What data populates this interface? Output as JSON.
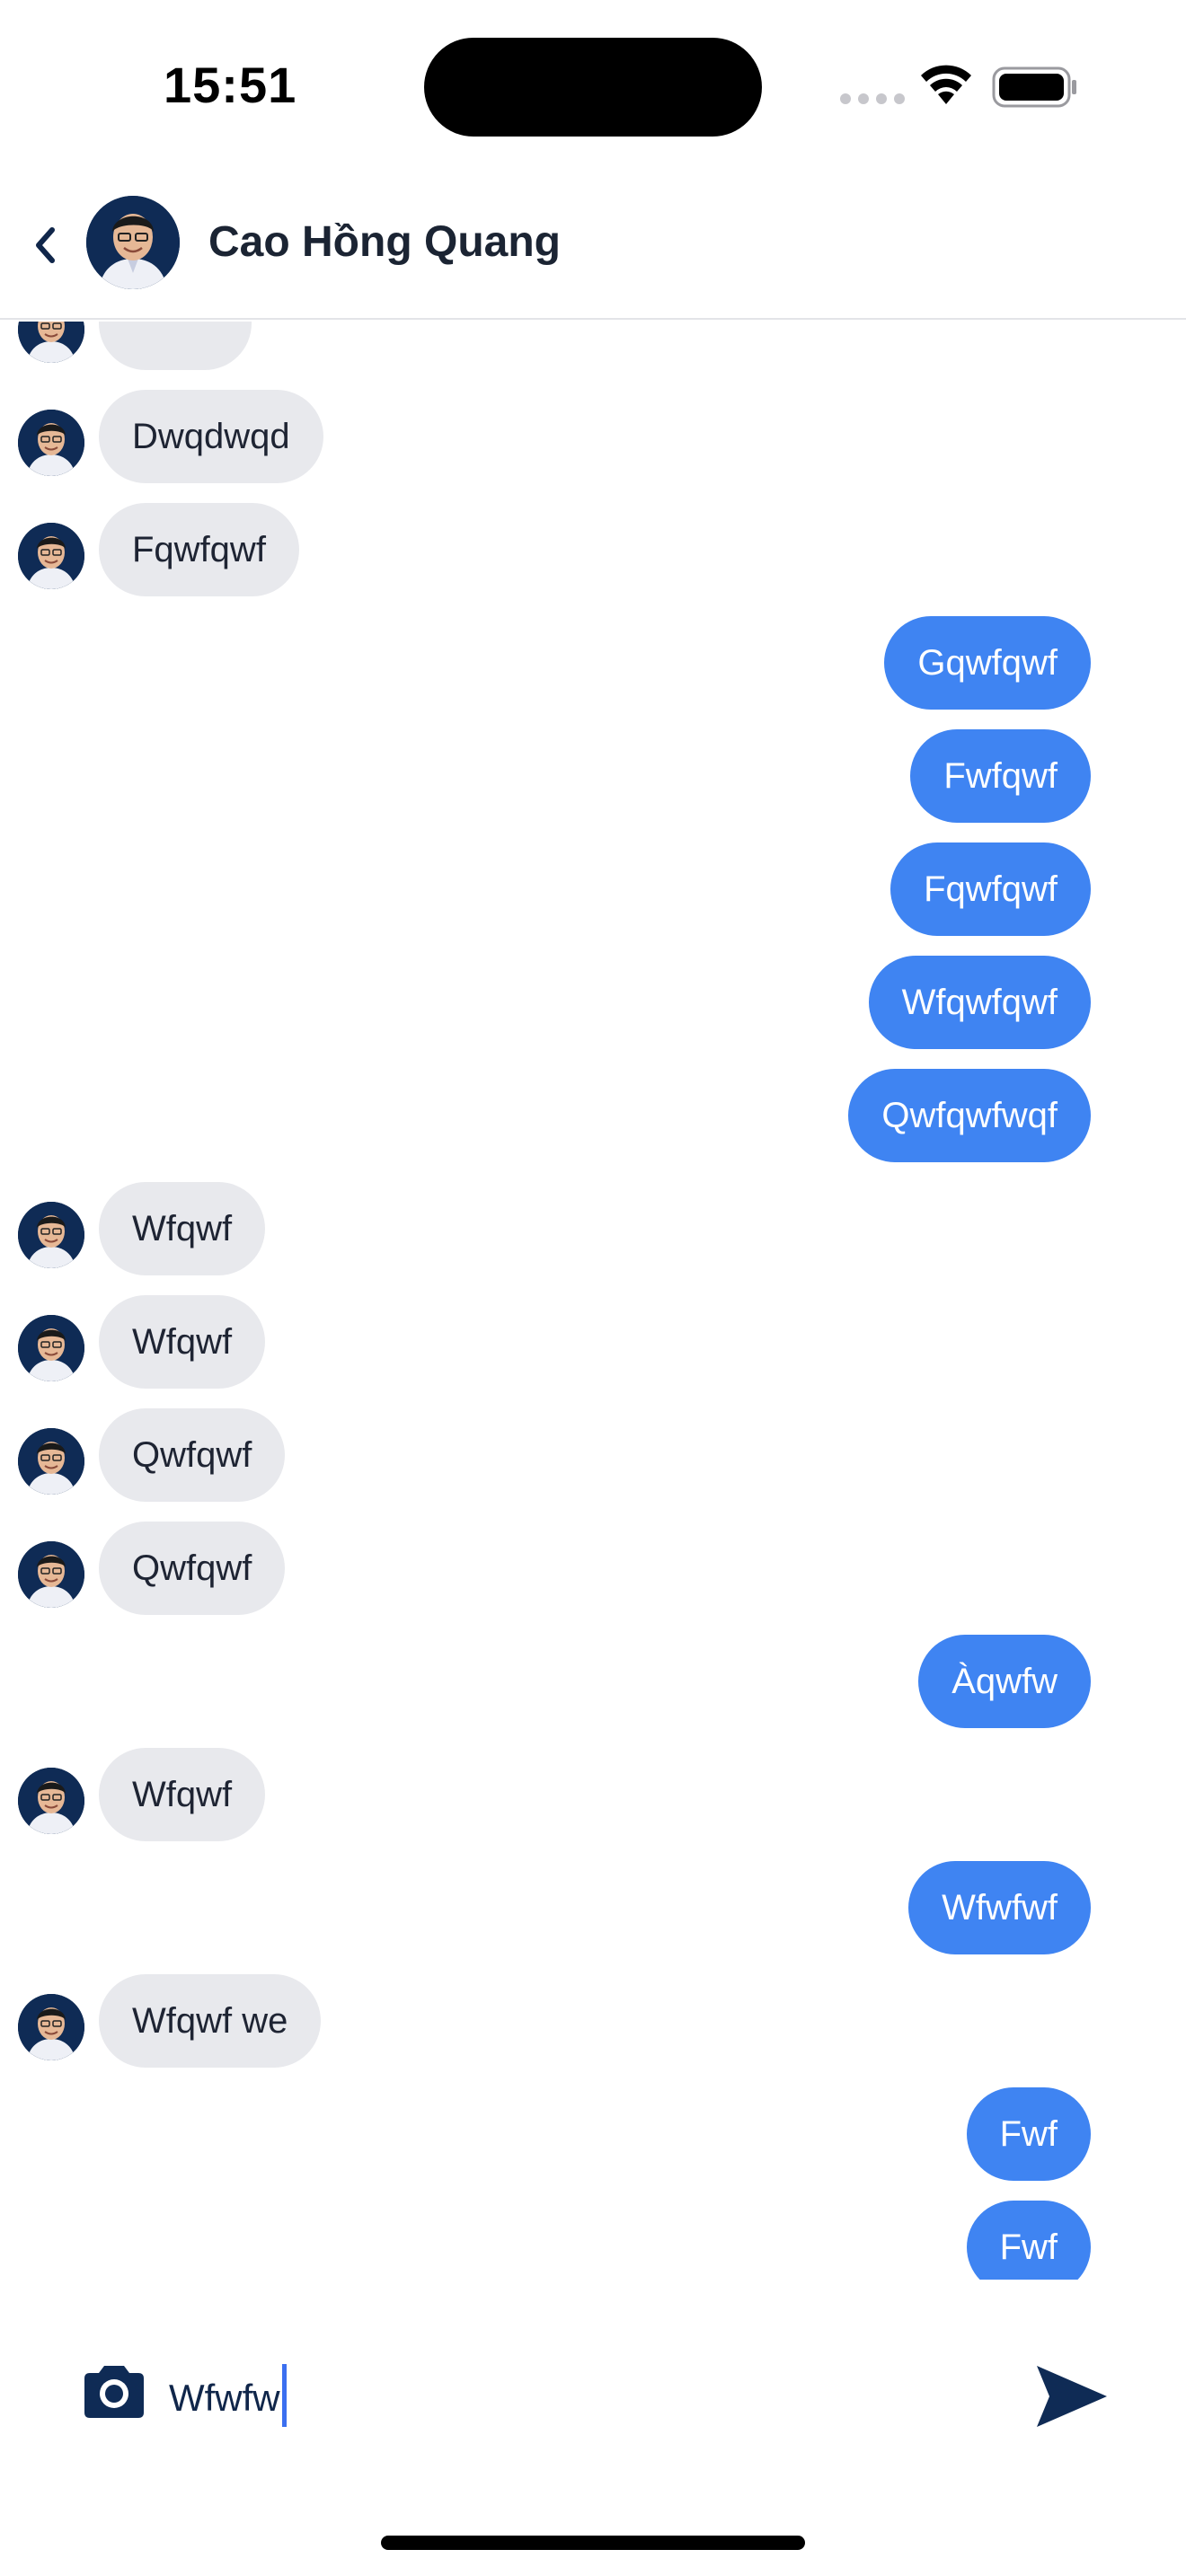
{
  "status_bar": {
    "time": "15:51"
  },
  "header": {
    "back_icon": "chevron-left-icon",
    "avatar_icon": "user-avatar",
    "contact_name": "Cao Hồng Quang"
  },
  "messages": [
    {
      "direction": "incoming",
      "text": ""
    },
    {
      "direction": "incoming",
      "text": "Dwqdwqd"
    },
    {
      "direction": "incoming",
      "text": "Fqwfqwf"
    },
    {
      "direction": "outgoing",
      "text": "Gqwfqwf"
    },
    {
      "direction": "outgoing",
      "text": "Fwfqwf"
    },
    {
      "direction": "outgoing",
      "text": "Fqwfqwf"
    },
    {
      "direction": "outgoing",
      "text": "Wfqwfqwf"
    },
    {
      "direction": "outgoing",
      "text": "Qwfqwfwqf"
    },
    {
      "direction": "incoming",
      "text": "Wfqwf"
    },
    {
      "direction": "incoming",
      "text": "Wfqwf"
    },
    {
      "direction": "incoming",
      "text": "Qwfqwf"
    },
    {
      "direction": "incoming",
      "text": "Qwfqwf"
    },
    {
      "direction": "outgoing",
      "text": "Àqwfw"
    },
    {
      "direction": "incoming",
      "text": "Wfqwf"
    },
    {
      "direction": "outgoing",
      "text": "Wfwfwf"
    },
    {
      "direction": "incoming",
      "text": "Wfqwf we"
    },
    {
      "direction": "outgoing",
      "text": "Fwf"
    },
    {
      "direction": "outgoing",
      "text": "Fwf"
    }
  ],
  "composer": {
    "camera_icon": "camera-icon",
    "value": "Wfwfw",
    "send_icon": "send-icon"
  },
  "colors": {
    "outgoing_bubble": "#3f84f2",
    "incoming_bubble": "#e8e9ed",
    "accent_dark": "#0f2b55"
  }
}
